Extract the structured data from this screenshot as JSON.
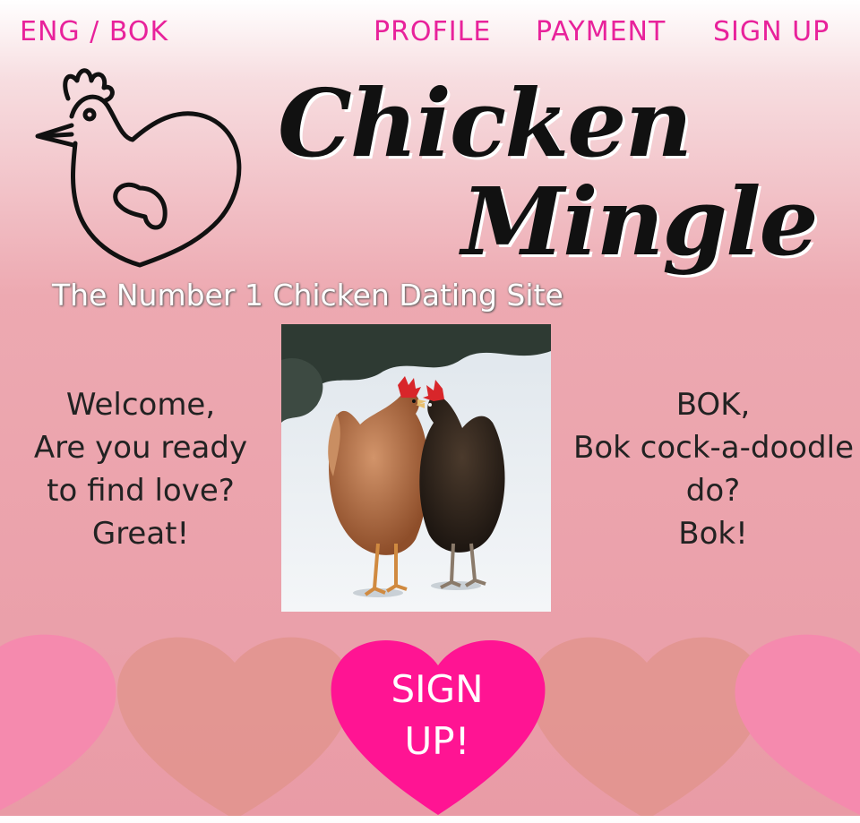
{
  "nav": {
    "language_toggle": "ENG / BOK",
    "profile": "PROFILE",
    "payment": "PAYMENT",
    "sign_up": "SIGN UP"
  },
  "brand": {
    "line1": "Chicken",
    "line2": "Mingle",
    "tagline": "The Number 1 Chicken Dating Site"
  },
  "welcome": {
    "line1": "Welcome,",
    "line2": "Are you ready",
    "line3": "to find love?",
    "line4": "Great!"
  },
  "bok": {
    "line1": "BOK,",
    "line2": "Bok cock-a-doodle",
    "line3": "do?",
    "line4": "Bok!"
  },
  "cta": {
    "line1": "SIGN",
    "line2": "UP!"
  },
  "colors": {
    "accent": "#e8229b",
    "cta_heart": "#ff1493",
    "side_heart_pink": "#f58aae",
    "side_heart_tan": "#e2958f"
  },
  "icons": {
    "logo": "chicken-heart-icon",
    "photo": "two-chickens-in-snow"
  }
}
